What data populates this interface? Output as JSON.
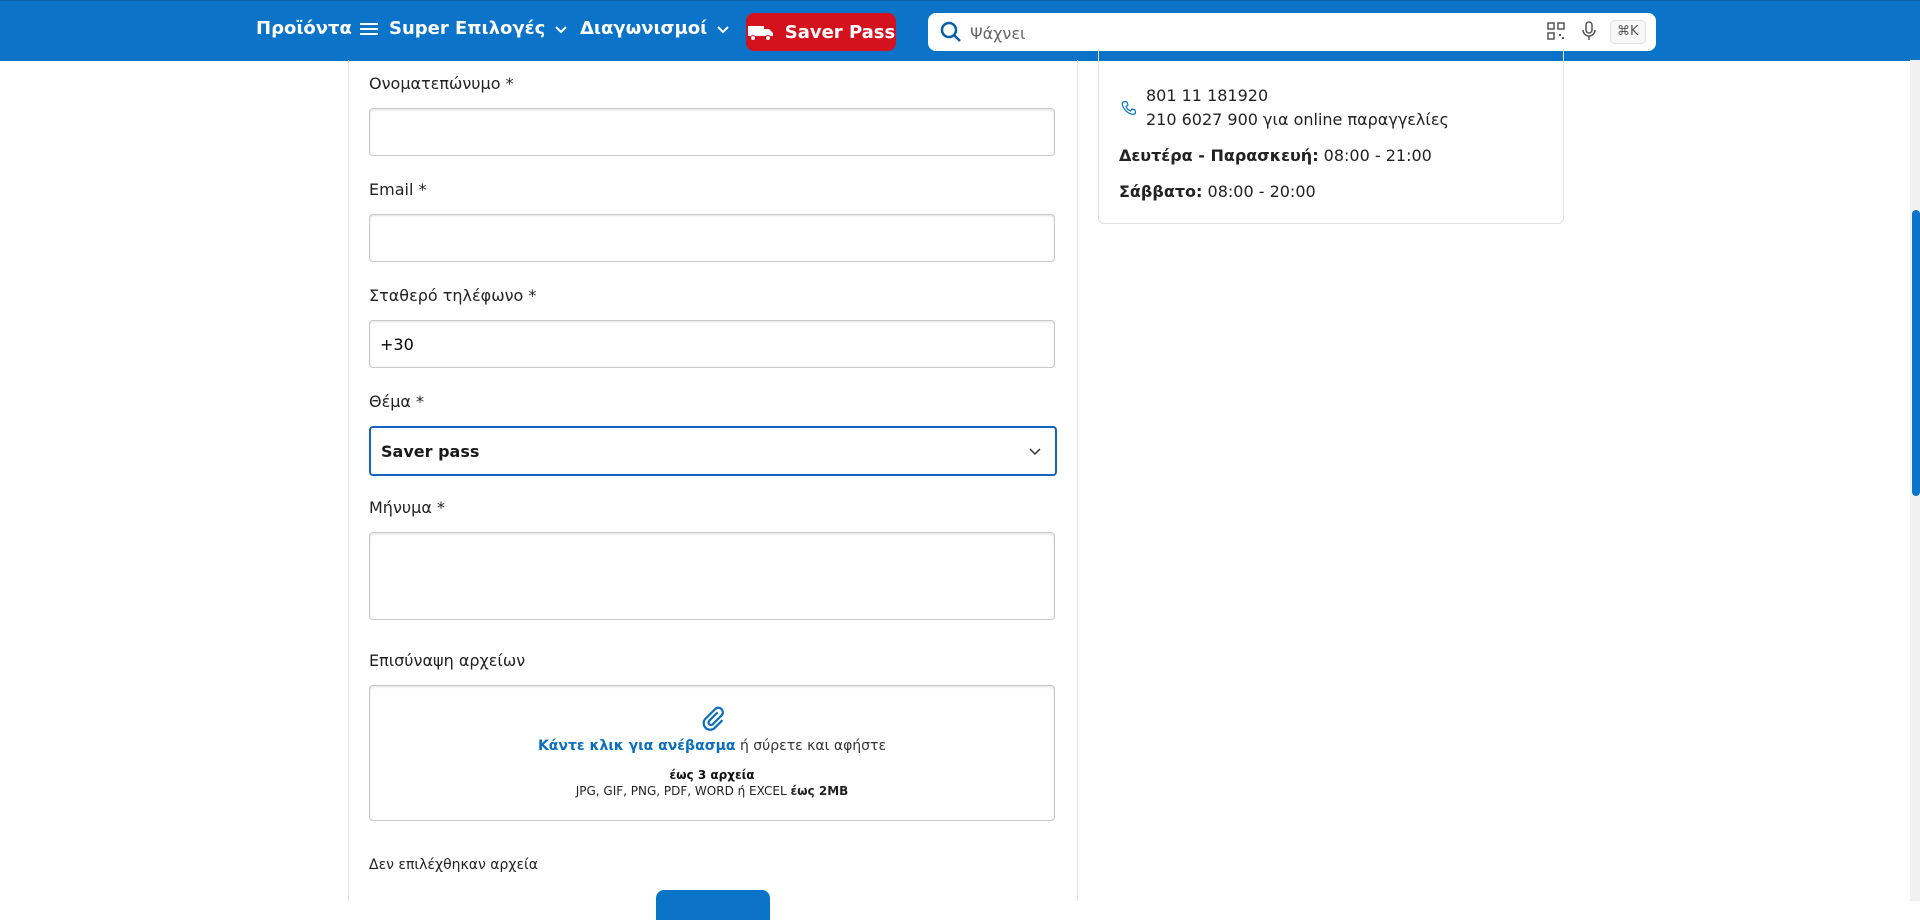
{
  "nav": {
    "products_label": "Προϊόντα",
    "super_label": "Super Επιλογές",
    "contests_label": "Διαγωνισμοί",
    "saver_pass_label": "Saver Pass"
  },
  "search": {
    "placeholder": "Ψάχνει",
    "shortcut": "⌘K"
  },
  "form": {
    "name_label": "Ονοματεπώνυμο *",
    "email_label": "Email *",
    "phone_label": "Σταθερό τηλέφωνο *",
    "phone_value": "+30",
    "subject_label": "Θέμα *",
    "subject_selected": "Saver pass",
    "message_label": "Μήνυμα *",
    "attach_label": "Επισύναψη αρχείων",
    "upload_link": "Κάντε κλικ για ανέβασμα",
    "upload_text": " ή σύρετε και αφήστε",
    "upload_limit": "έως 3 αρχεία",
    "upload_types": "JPG, GIF, PNG, PDF, WORD ή EXCEL ",
    "upload_size": "έως 2MB",
    "no_files": "Δεν επιλέχθηκαν αρχεία"
  },
  "contact": {
    "phone1": "801 11 181920",
    "phone2": "210 6027 900  για online παραγγελίες",
    "weekday_label": "Δευτέρα - Παρασκευή:",
    "weekday_hours": " 08:00 - 21:00",
    "saturday_label": "Σάββατο:",
    "saturday_hours": " 08:00 - 20:00"
  },
  "colors": {
    "brand_blue": "#0b74c9",
    "saver_red": "#d3121d",
    "link_blue": "#0b6fbd"
  }
}
